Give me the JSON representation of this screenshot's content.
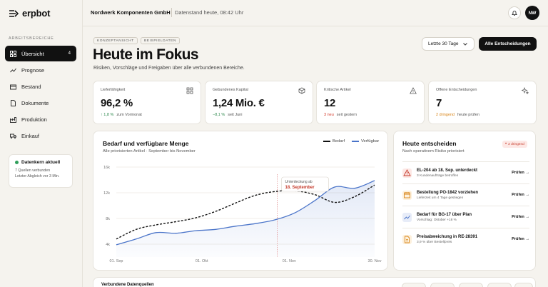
{
  "app": {
    "name": "erpbot"
  },
  "sidebar": {
    "section_label": "ARBEITSBEREICHE",
    "items": [
      {
        "label": "Übersicht",
        "icon": "grid-icon",
        "badge": "4",
        "active": true
      },
      {
        "label": "Prognose",
        "icon": "trend-icon"
      },
      {
        "label": "Bestand",
        "icon": "box-icon"
      },
      {
        "label": "Dokumente",
        "icon": "document-icon"
      },
      {
        "label": "Produktion",
        "icon": "factory-icon"
      },
      {
        "label": "Einkauf",
        "icon": "truck-icon"
      }
    ],
    "status": {
      "title": "Datenkern aktuell",
      "line1": "7 Quellen verbunden",
      "line2": "Letzter Abgleich vor 3 Min."
    }
  },
  "topbar": {
    "company": "Nordwerk Komponenten GmbH",
    "datastand": "Datenstand heute, 08:42 Uhr",
    "avatar": "NW"
  },
  "header": {
    "chips": [
      "KONZEPTANSICHT",
      "BEISPIELDATEN"
    ],
    "title": "Heute im Fokus",
    "subtitle": "Risiken, Vorschläge und Freigaben über alle verbundenen Bereiche.",
    "period": "Letzte 30 Tage",
    "cta": "Alle Entscheidungen"
  },
  "kpis": [
    {
      "label": "Lieferfähigkeit",
      "value": "96,2 %",
      "delta": "↑ 1,8 %",
      "note": "zum Vormonat",
      "tone": "g"
    },
    {
      "label": "Gebundenes Kapital",
      "value": "1,24 Mio. €",
      "delta": "−8,1 %",
      "note": "seit Juni",
      "tone": "g"
    },
    {
      "label": "Kritische Artikel",
      "value": "12",
      "delta": "3 neu",
      "note": "seit gestern",
      "tone": "r"
    },
    {
      "label": "Offene Entscheidungen",
      "value": "7",
      "delta": "2 dringend",
      "note": "heute prüfen",
      "tone": "o"
    }
  ],
  "chart": {
    "title": "Bedarf und verfügbare Menge",
    "subtitle": "Alle priorisierten Artikel · September bis November",
    "tooltip": {
      "label": "Unterdeckung ab",
      "date": "18. September"
    }
  },
  "chart_data": {
    "type": "line",
    "x": [
      "01. Sep",
      "08. Sep",
      "15. Sep",
      "22. Sep",
      "29. Sep",
      "06. Okt",
      "13. Okt",
      "20. Okt",
      "27. Okt",
      "03. Nov",
      "10. Nov",
      "17. Nov",
      "24. Nov",
      "30. Nov"
    ],
    "x_ticks": [
      "01. Sep",
      "01. Okt",
      "01. Nov",
      "30. Nov"
    ],
    "y_ticks": [
      "4k",
      "8k",
      "12k",
      "16k"
    ],
    "ylim": [
      2000,
      16000
    ],
    "series": [
      {
        "name": "Bedarf",
        "color": "#111111",
        "dashed": true,
        "values": [
          4800,
          6300,
          7000,
          7500,
          8100,
          9100,
          10400,
          11600,
          12200,
          12300,
          11700,
          10500,
          11400,
          13200
        ]
      },
      {
        "name": "Verfügbar",
        "color": "#4a74c9",
        "dashed": false,
        "values": [
          3900,
          4800,
          5800,
          5700,
          6100,
          6300,
          6800,
          7200,
          7800,
          8900,
          10800,
          12900,
          12700,
          13900
        ]
      }
    ],
    "legend_position": "top-right"
  },
  "decisions": {
    "title": "Heute entscheiden",
    "subtitle": "Nach operativem Risiko priorisiert",
    "urgent_badge": "2 dringend",
    "items": [
      {
        "title": "EL-204 ab 18. Sep. unterdeckt",
        "sub": "3 Kundenaufträge betroffen",
        "action": "Prüfen →",
        "icon": "warning-icon",
        "bg": "#fde8e5",
        "fg": "#c53a2b"
      },
      {
        "title": "Bestellung PO-1842 vorziehen",
        "sub": "Lieferzeit um 4 Tage gestiegen",
        "action": "Prüfen →",
        "icon": "calendar-icon",
        "bg": "#fdf0dc",
        "fg": "#d9861a"
      },
      {
        "title": "Bedarf für BG-17 über Plan",
        "sub": "Vorschlag: Oktober +18 %",
        "action": "Prüfen →",
        "icon": "trend-icon",
        "bg": "#e7ecf8",
        "fg": "#4a74c9"
      },
      {
        "title": "Preisabweichung in RE-28391",
        "sub": "3,9 % über Bestellpreis",
        "action": "Prüfen →",
        "icon": "document-icon",
        "bg": "#fdf0dc",
        "fg": "#d9861a"
      }
    ]
  },
  "bottom": {
    "title": "Verbundene Datenquellen"
  }
}
